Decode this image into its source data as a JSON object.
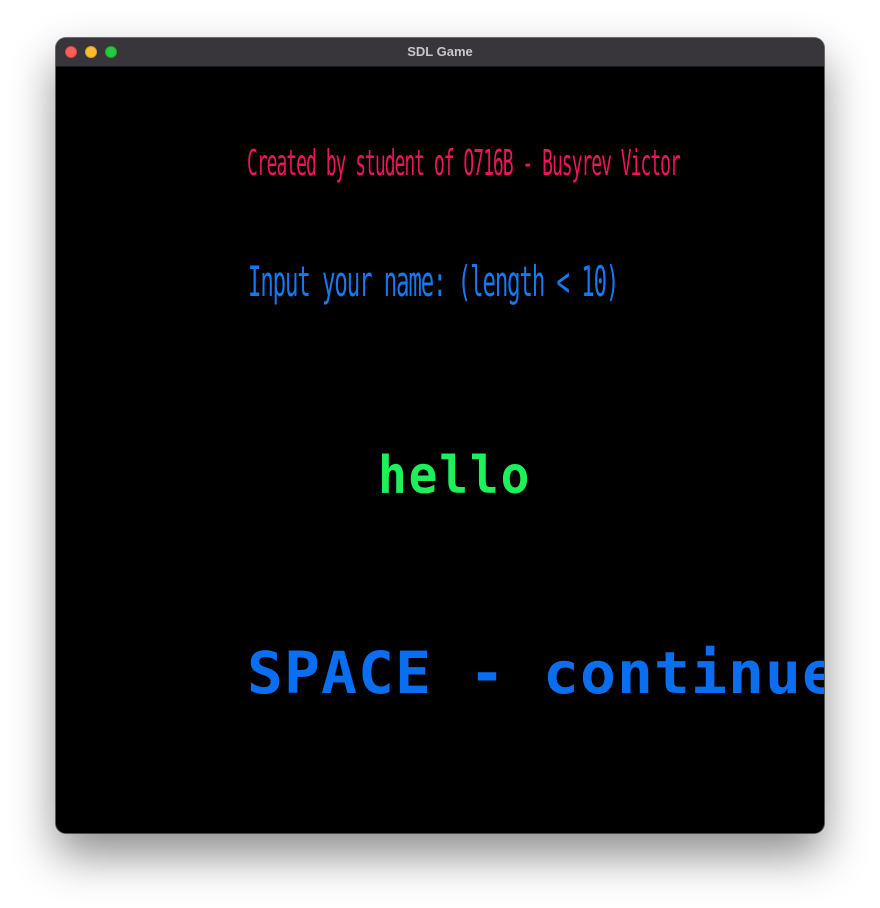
{
  "window": {
    "title": "SDL Game"
  },
  "game": {
    "credits": "Created by student of O716B - Busyrev Victor",
    "prompt": "Input your name: (length < 10)",
    "name_input": "hello",
    "space_hint": "SPACE - continue"
  },
  "colors": {
    "background": "#000000",
    "credits": "#f0145a",
    "prompt": "#1679f0",
    "name_input": "#1ef05a",
    "space_hint": "#0a6ef0"
  }
}
